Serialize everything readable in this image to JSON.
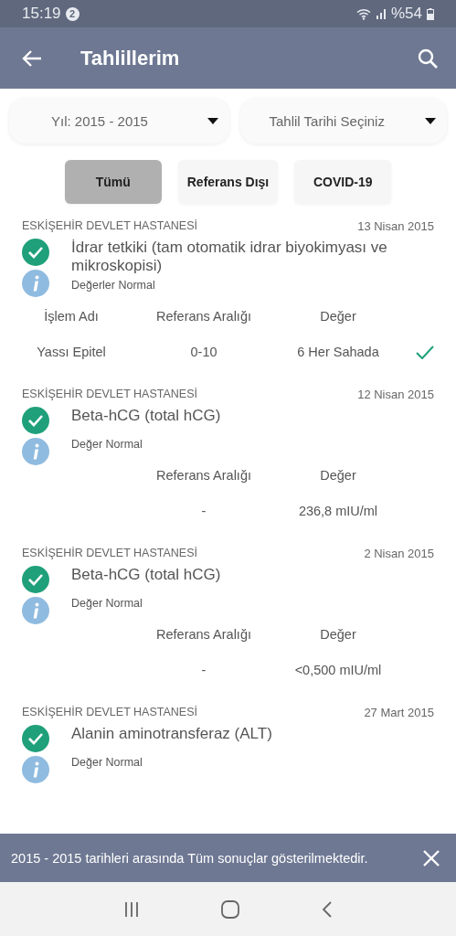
{
  "status_bar": {
    "time": "15:19",
    "notifications": "2",
    "battery": "%54"
  },
  "app_bar": {
    "title": "Tahlillerim"
  },
  "filters": [
    {
      "value": "Yıl: 2015 - 2015"
    },
    {
      "value": "Tahlil Tarihi Seçiniz"
    }
  ],
  "tabs": [
    {
      "label": "Tümü",
      "selected": true
    },
    {
      "label": "Referans Dışı",
      "selected": false
    },
    {
      "label": "COVID-19",
      "selected": false
    }
  ],
  "results": [
    {
      "hospital": "ESKİŞEHİR DEVLET HASTANESİ",
      "date": "13 Nisan 2015",
      "title": "İdrar tetkiki (tam otomatik idrar biyokimyası ve mikroskopisi)",
      "status": "Değerler Normal",
      "normal": true,
      "header": {
        "name": "İşlem Adı",
        "range": "Referans Aralığı",
        "value": "Değer"
      },
      "rows": [
        {
          "name": "Yassı Epitel",
          "range": "0-10",
          "value": "6 Her Sahada",
          "ok": true
        }
      ]
    },
    {
      "hospital": "ESKİŞEHİR DEVLET HASTANESİ",
      "date": "12 Nisan 2015",
      "title": "Beta-hCG (total hCG)",
      "status": "Değer Normal",
      "normal": true,
      "header": {
        "range": "Referans Aralığı",
        "value": "Değer"
      },
      "rows": [
        {
          "range": "-",
          "value": "236,8 mIU/ml",
          "ok": false
        }
      ]
    },
    {
      "hospital": "ESKİŞEHİR DEVLET HASTANESİ",
      "date": "2 Nisan 2015",
      "title": "Beta-hCG (total hCG)",
      "status": "Değer Normal",
      "normal": true,
      "header": {
        "range": "Referans Aralığı",
        "value": "Değer"
      },
      "rows": [
        {
          "range": "-",
          "value": "<0,500 mIU/ml",
          "ok": false
        }
      ]
    },
    {
      "hospital": "ESKİŞEHİR DEVLET HASTANESİ",
      "date": "27 Mart 2015",
      "title": "Alanin aminotransferaz (ALT)",
      "status": "Değer Normal",
      "normal": true
    }
  ],
  "snackbar": {
    "message": "2015 - 2015 tarihleri arasında Tüm sonuçlar gösterilmektedir."
  }
}
